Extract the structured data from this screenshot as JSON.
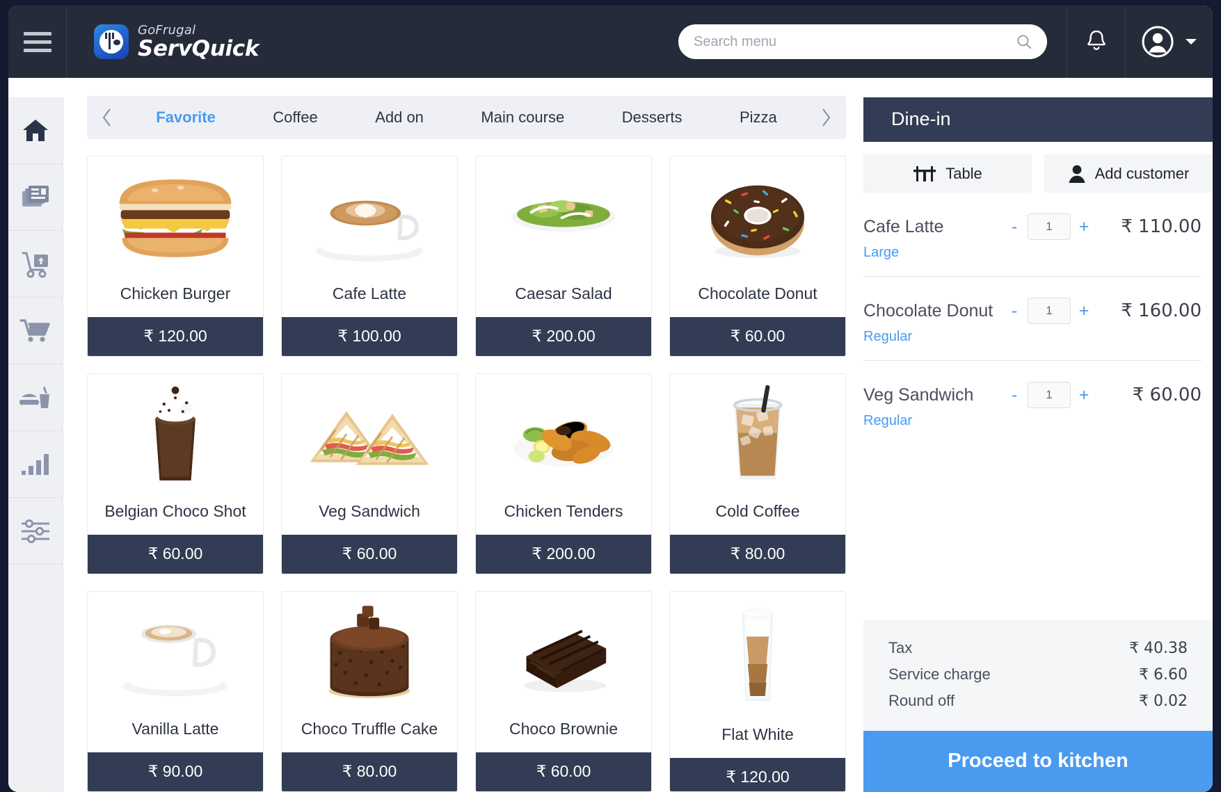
{
  "brand": {
    "top": "GoFrugal",
    "bottom": "ServQuick"
  },
  "header": {
    "menu_icon": "hamburger-icon",
    "search_placeholder": "Search menu",
    "search_value": "",
    "search_icon": "search-icon",
    "notification_icon": "bell-icon",
    "profile_icon": "user-avatar-icon",
    "profile_chevron": "chevron-down-icon"
  },
  "sidebar": {
    "items": [
      {
        "icon": "home-icon",
        "name": "sidebar-item-home",
        "active": true
      },
      {
        "icon": "bills-icon",
        "name": "sidebar-item-bills",
        "active": false
      },
      {
        "icon": "delivery-icon",
        "name": "sidebar-item-delivery",
        "active": false
      },
      {
        "icon": "cart-icon",
        "name": "sidebar-item-cart",
        "active": false
      },
      {
        "icon": "food-drink-icon",
        "name": "sidebar-item-menu",
        "active": false
      },
      {
        "icon": "bar-chart-icon",
        "name": "sidebar-item-reports",
        "active": false
      },
      {
        "icon": "sliders-icon",
        "name": "sidebar-item-settings",
        "active": false
      }
    ]
  },
  "tabs": {
    "prev_icon": "chevron-left-icon",
    "next_icon": "chevron-right-icon",
    "items": [
      {
        "label": "Favorite",
        "active": true
      },
      {
        "label": "Coffee",
        "active": false
      },
      {
        "label": "Add on",
        "active": false
      },
      {
        "label": "Main course",
        "active": false
      },
      {
        "label": "Desserts",
        "active": false
      },
      {
        "label": "Pizza",
        "active": false
      }
    ]
  },
  "products": [
    {
      "name": "Chicken Burger",
      "price": "₹ 120.00",
      "art": "burger"
    },
    {
      "name": "Cafe Latte",
      "price": "₹ 100.00",
      "art": "latte-cup"
    },
    {
      "name": "Caesar Salad",
      "price": "₹ 200.00",
      "art": "salad-bowl"
    },
    {
      "name": "Chocolate Donut",
      "price": "₹ 60.00",
      "art": "donut"
    },
    {
      "name": "Belgian Choco Shot",
      "price": "₹ 60.00",
      "art": "choco-shake"
    },
    {
      "name": "Veg Sandwich",
      "price": "₹ 60.00",
      "art": "sandwich"
    },
    {
      "name": "Chicken Tenders",
      "price": "₹ 200.00",
      "art": "tenders-plate"
    },
    {
      "name": "Cold Coffee",
      "price": "₹ 80.00",
      "art": "iced-coffee"
    },
    {
      "name": "Vanilla Latte",
      "price": "₹ 90.00",
      "art": "latte-mug"
    },
    {
      "name": "Choco Truffle Cake",
      "price": "₹ 80.00",
      "art": "truffle-cake"
    },
    {
      "name": "Choco Brownie",
      "price": "₹ 60.00",
      "art": "brownie"
    },
    {
      "name": "Flat White",
      "price": "₹ 120.00",
      "art": "flat-white-glass"
    }
  ],
  "order": {
    "mode": "Dine-in",
    "table_button": "Table",
    "table_icon": "table-icon",
    "add_customer_button": "Add customer",
    "add_customer_icon": "person-icon",
    "minus_label": "-",
    "plus_label": "+",
    "items": [
      {
        "name": "Cafe Latte",
        "qty": "1",
        "price": "₹ 110.00",
        "variant": "Large"
      },
      {
        "name": "Chocolate Donut",
        "qty": "1",
        "price": "₹ 160.00",
        "variant": "Regular"
      },
      {
        "name": "Veg Sandwich",
        "qty": "1",
        "price": "₹ 60.00",
        "variant": "Regular"
      }
    ],
    "totals": [
      {
        "label": "Tax",
        "value": "₹ 40.38"
      },
      {
        "label": "Service charge",
        "value": "₹ 6.60"
      },
      {
        "label": "Round off",
        "value": "₹ 0.02"
      }
    ],
    "proceed_label": "Proceed to kitchen"
  },
  "colors": {
    "header_bg": "#262b3a",
    "panel_dark": "#323c54",
    "accent_blue": "#4a9bf0",
    "sidebar_bg": "#eff0f4",
    "tabs_bg": "#eef0f5",
    "page_backdrop": "#151a31"
  }
}
